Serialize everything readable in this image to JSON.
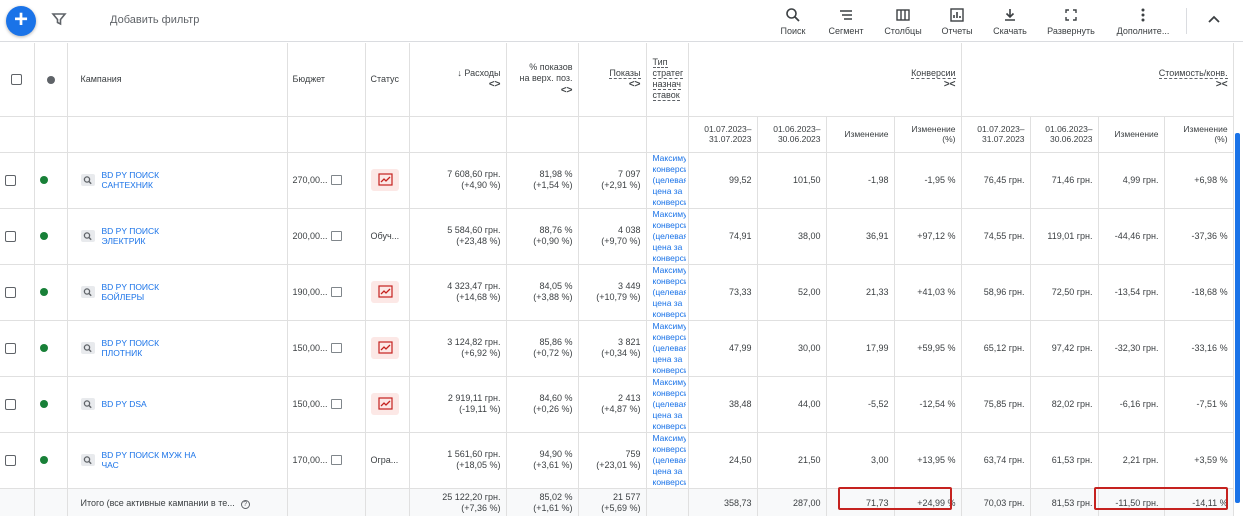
{
  "toolbar": {
    "add_filter": "Добавить фильтр",
    "tools": [
      {
        "label": "Поиск",
        "icon": "search-icon"
      },
      {
        "label": "Сегмент",
        "icon": "segment-icon"
      },
      {
        "label": "Столбцы",
        "icon": "columns-icon"
      },
      {
        "label": "Отчеты",
        "icon": "reports-icon"
      },
      {
        "label": "Скачать",
        "icon": "download-icon"
      },
      {
        "label": "Развернуть",
        "icon": "expand-icon"
      },
      {
        "label": "Дополните...",
        "icon": "more-vert-icon"
      }
    ]
  },
  "header": {
    "campaign": "Кампания",
    "budget": "Бюджет",
    "status": "Статус",
    "cost": "Расходы",
    "top_impr_1": "% показов",
    "top_impr_2": "на верх. поз.",
    "impressions": "Показы",
    "strategy_1": "Тип",
    "strategy_2": "стратег",
    "strategy_3": "назнач",
    "strategy_4": "ставок",
    "conversions": "Конверсии",
    "cost_conv": "Стоимость/конв.",
    "sort_arrows": "<>",
    "expand_arrows": "><",
    "period1_a": "01.07.2023–",
    "period1_b": "31.07.2023",
    "period2_a": "01.06.2023–",
    "period2_b": "30.06.2023",
    "change": "Изменение",
    "change_pct_a": "Изменение",
    "change_pct_b": "(%)"
  },
  "rows": [
    {
      "name": "BD PY ПОИСК САНТЕХНИК",
      "budget": "270,00...",
      "status_text": "",
      "status_chip": true,
      "cost": "7 608,60 грн.",
      "cost_ch": "(+4,90 %)",
      "top": "81,98 %",
      "top_ch": "(+1,54 %)",
      "impr": "7 097",
      "impr_ch": "(+2,91 %)",
      "strategy": "Максимум конверсий (целевая цена за конверсию)",
      "conv1": "99,52",
      "conv2": "101,50",
      "conv_ch": "-1,98",
      "conv_pct": "-1,95 %",
      "cpc1": "76,45 грн.",
      "cpc2": "71,46 грн.",
      "cpc_ch": "4,99 грн.",
      "cpc_pct": "+6,98 %"
    },
    {
      "name": "BD PY ПОИСК ЭЛЕКТРИК",
      "budget": "200,00...",
      "status_text": "Обуч...",
      "status_chip": false,
      "cost": "5 584,60 грн.",
      "cost_ch": "(+23,48 %)",
      "top": "88,76 %",
      "top_ch": "(+0,90 %)",
      "impr": "4 038",
      "impr_ch": "(+9,70 %)",
      "strategy": "Максимум конверсий (целевая цена за конверсию)",
      "conv1": "74,91",
      "conv2": "38,00",
      "conv_ch": "36,91",
      "conv_pct": "+97,12 %",
      "cpc1": "74,55 грн.",
      "cpc2": "119,01 грн.",
      "cpc_ch": "-44,46 грн.",
      "cpc_pct": "-37,36 %"
    },
    {
      "name": "BD PY ПОИСК БОЙЛЕРЫ",
      "budget": "190,00...",
      "status_text": "",
      "status_chip": true,
      "cost": "4 323,47 грн.",
      "cost_ch": "(+14,68 %)",
      "top": "84,05 %",
      "top_ch": "(+3,88 %)",
      "impr": "3 449",
      "impr_ch": "(+10,79 %)",
      "strategy": "Максимум конверсий (целевая цена за конверсию)",
      "conv1": "73,33",
      "conv2": "52,00",
      "conv_ch": "21,33",
      "conv_pct": "+41,03 %",
      "cpc1": "58,96 грн.",
      "cpc2": "72,50 грн.",
      "cpc_ch": "-13,54 грн.",
      "cpc_pct": "-18,68 %"
    },
    {
      "name": "BD PY ПОИСК ПЛОТНИК",
      "budget": "150,00...",
      "status_text": "",
      "status_chip": true,
      "cost": "3 124,82 грн.",
      "cost_ch": "(+6,92 %)",
      "top": "85,86 %",
      "top_ch": "(+0,72 %)",
      "impr": "3 821",
      "impr_ch": "(+0,34 %)",
      "strategy": "Максимум конверсий (целевая цена за конверсию)",
      "conv1": "47,99",
      "conv2": "30,00",
      "conv_ch": "17,99",
      "conv_pct": "+59,95 %",
      "cpc1": "65,12 грн.",
      "cpc2": "97,42 грн.",
      "cpc_ch": "-32,30 грн.",
      "cpc_pct": "-33,16 %"
    },
    {
      "name": "BD PY DSA",
      "budget": "150,00...",
      "status_text": "",
      "status_chip": true,
      "cost": "2 919,11 грн.",
      "cost_ch": "(-19,11 %)",
      "top": "84,60 %",
      "top_ch": "(+0,26 %)",
      "impr": "2 413",
      "impr_ch": "(+4,87 %)",
      "strategy": "Максимум конверсий (целевая цена за конверсию)",
      "conv1": "38,48",
      "conv2": "44,00",
      "conv_ch": "-5,52",
      "conv_pct": "-12,54 %",
      "cpc1": "75,85 грн.",
      "cpc2": "82,02 грн.",
      "cpc_ch": "-6,16 грн.",
      "cpc_pct": "-7,51 %"
    },
    {
      "name": "BD PY ПОИСК МУЖ НА ЧАС",
      "budget": "170,00...",
      "status_text": "Огра...",
      "status_chip": false,
      "cost": "1 561,60 грн.",
      "cost_ch": "(+18,05 %)",
      "top": "94,90 %",
      "top_ch": "(+3,61 %)",
      "impr": "759",
      "impr_ch": "(+23,01 %)",
      "strategy": "Максимум конверсий (целевая цена за конверсию)",
      "conv1": "24,50",
      "conv2": "21,50",
      "conv_ch": "3,00",
      "conv_pct": "+13,95 %",
      "cpc1": "63,74 грн.",
      "cpc2": "61,53 грн.",
      "cpc_ch": "2,21 грн.",
      "cpc_pct": "+3,59 %"
    }
  ],
  "total": {
    "label": "Итого (все активные кампании в те...",
    "cost": "25 122,20 грн.",
    "cost_ch": "(+7,36 %)",
    "top": "85,02 %",
    "top_ch": "(+1,61 %)",
    "impr": "21 577",
    "impr_ch": "(+5,69 %)",
    "conv1": "358,73",
    "conv2": "287,00",
    "conv_ch": "71,73",
    "conv_pct": "+24,99 %",
    "cpc1": "70,03 грн.",
    "cpc2": "81,53 грн.",
    "cpc_ch": "-11,50 грн.",
    "cpc_pct": "-14,11 %"
  },
  "colors": {
    "accent": "#1a73e8",
    "enabled": "#188038",
    "highlight": "#c5221f"
  }
}
